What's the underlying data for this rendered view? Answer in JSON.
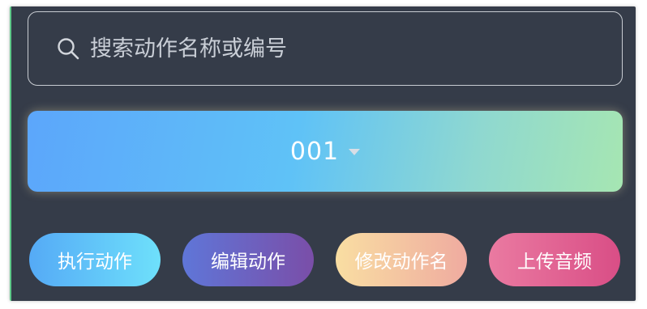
{
  "search": {
    "placeholder": "搜索动作名称或编号",
    "value": ""
  },
  "selector": {
    "value": "001"
  },
  "actions": {
    "execute_label": "执行动作",
    "edit_label": "编辑动作",
    "rename_label": "修改动作名",
    "upload_label": "上传音频"
  },
  "icons": {
    "search": "search-icon",
    "dropdown": "caret-down-icon"
  },
  "colors": {
    "panel_bg": "#353c49",
    "accent_left_border": "#5fc98a",
    "selector_gradient_start": "#5ca6fb",
    "selector_gradient_end": "#a6e6b2",
    "execute_gradient": [
      "#55aaf6",
      "#6ee0fb"
    ],
    "edit_gradient": [
      "#5f76d8",
      "#7a4ea8"
    ],
    "rename_gradient": [
      "#f9dea2",
      "#efaba0"
    ],
    "upload_gradient": [
      "#ea7aa1",
      "#d94e86"
    ]
  }
}
